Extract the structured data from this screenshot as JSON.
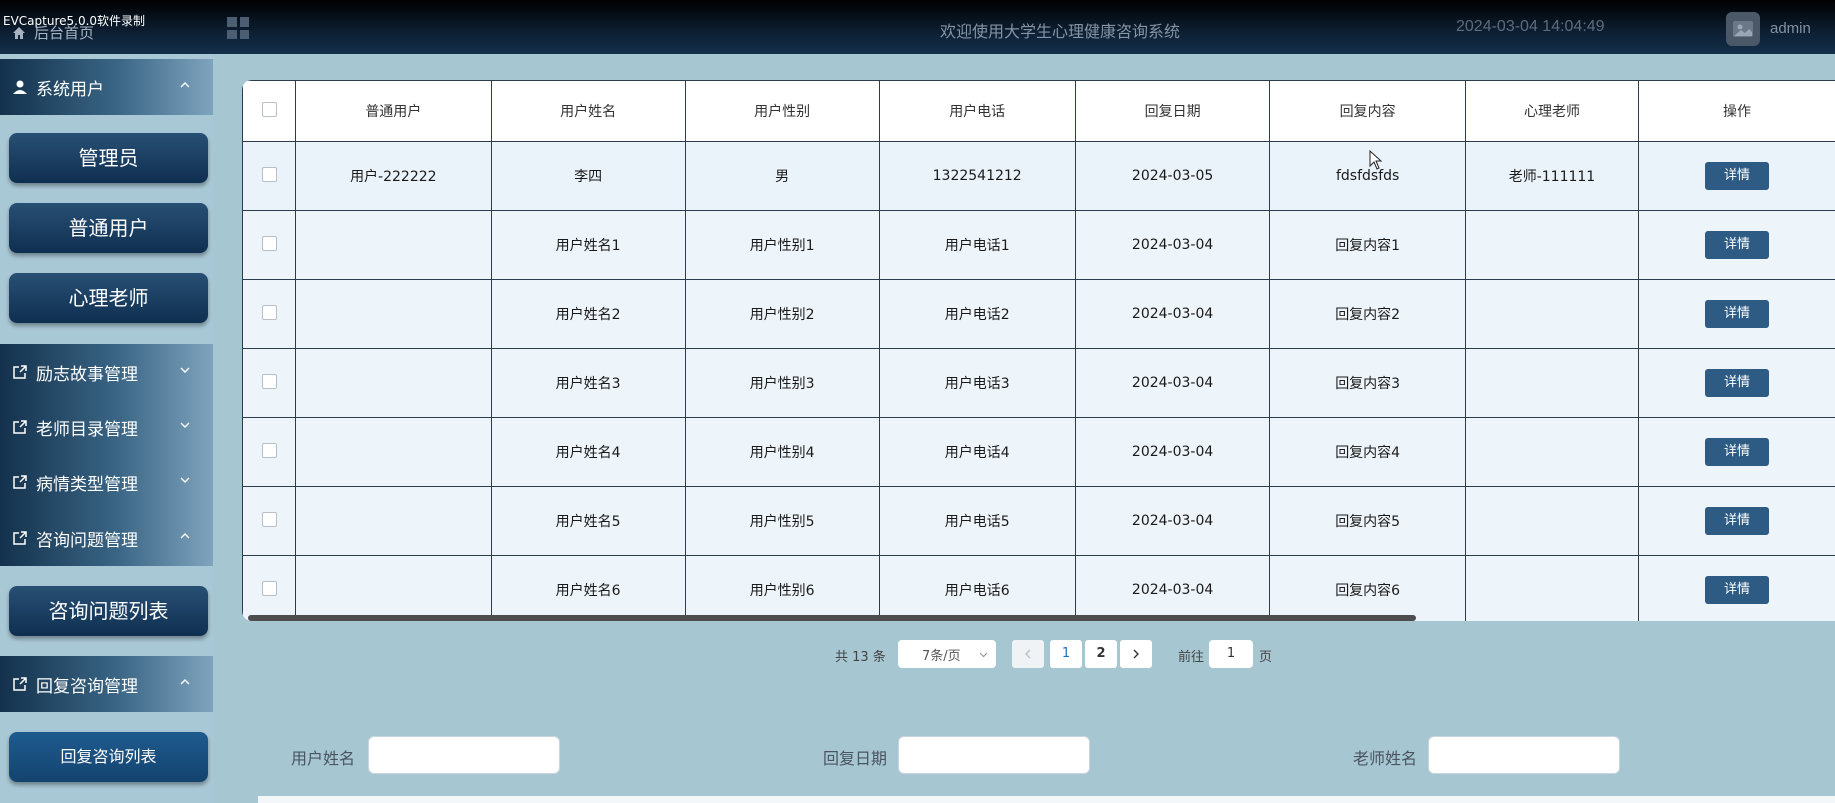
{
  "watermark": "EVCapture5.0.0软件录制",
  "header": {
    "home_label": "后台首页",
    "title": "欢迎使用大学生心理健康咨询系统",
    "datetime": "2024-03-04 14:04:49",
    "username": "admin"
  },
  "sidebar": {
    "groups": [
      {
        "label": "系统用户",
        "items": [
          "管理员",
          "普通用户",
          "心理老师"
        ]
      },
      {
        "label": "励志故事管理"
      },
      {
        "label": "老师目录管理"
      },
      {
        "label": "病情类型管理"
      },
      {
        "label": "咨询问题管理",
        "items": [
          "咨询问题列表"
        ]
      },
      {
        "label": "回复咨询管理",
        "items": [
          "回复咨询列表"
        ]
      }
    ]
  },
  "table": {
    "headers": [
      "普通用户",
      "用户姓名",
      "用户性别",
      "用户电话",
      "回复日期",
      "回复内容",
      "心理老师",
      "操作"
    ],
    "action_label": "详情",
    "rows": [
      [
        "用户-222222",
        "李四",
        "男",
        "1322541212",
        "2024-03-05",
        "fdsfdsfds",
        "老师-111111"
      ],
      [
        "",
        "用户姓名1",
        "用户性别1",
        "用户电话1",
        "2024-03-04",
        "回复内容1",
        ""
      ],
      [
        "",
        "用户姓名2",
        "用户性别2",
        "用户电话2",
        "2024-03-04",
        "回复内容2",
        ""
      ],
      [
        "",
        "用户姓名3",
        "用户性别3",
        "用户电话3",
        "2024-03-04",
        "回复内容3",
        ""
      ],
      [
        "",
        "用户姓名4",
        "用户性别4",
        "用户电话4",
        "2024-03-04",
        "回复内容4",
        ""
      ],
      [
        "",
        "用户姓名5",
        "用户性别5",
        "用户电话5",
        "2024-03-04",
        "回复内容5",
        ""
      ],
      [
        "",
        "用户姓名6",
        "用户性别6",
        "用户电话6",
        "2024-03-04",
        "回复内容6",
        ""
      ]
    ]
  },
  "pagination": {
    "total": "共 13 条",
    "page_size": "7条/页",
    "pages": [
      "1",
      "2"
    ],
    "goto_label": "前往",
    "goto_value": "1",
    "page_suffix": "页"
  },
  "search": {
    "user_name_label": "用户姓名",
    "reply_date_label": "回复日期",
    "teacher_name_label": "老师姓名"
  }
}
